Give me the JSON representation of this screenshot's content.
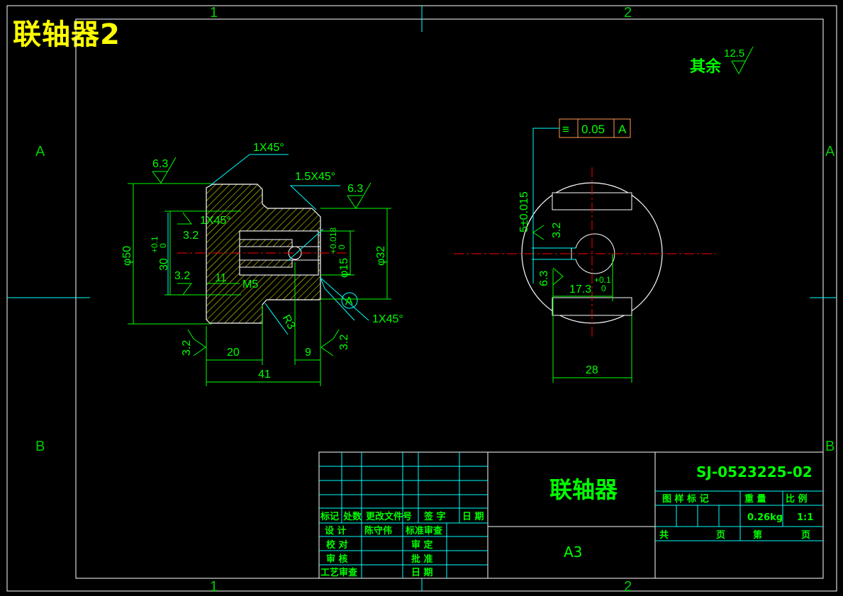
{
  "drawing_title": "联轴器2",
  "frame": {
    "zones_top": [
      "1",
      "2"
    ],
    "zones_bottom": [
      "1",
      "2"
    ],
    "rows_left": [
      "A",
      "B"
    ],
    "rows_right": [
      "A",
      "B"
    ]
  },
  "roughness_note": {
    "label": "其余",
    "value": "12.5"
  },
  "section_view": {
    "chamfers": [
      "1X45°",
      "1.5X45°",
      "1X45°",
      "1X45°"
    ],
    "roughness": [
      "6.3",
      "6.3",
      "3.2",
      "3.2",
      "3.2",
      "3.2"
    ],
    "dims": {
      "dia50": "φ50",
      "dia30": "30",
      "dia30_tol_upper": "+0.1",
      "dia30_tol_lower": "0",
      "dia32": "φ32",
      "dia15": "φ15",
      "dia15_tol_upper": "+0.018",
      "dia15_tol_lower": "0",
      "d11": "11",
      "m5": "M5",
      "r3": "R3",
      "d20": "20",
      "d9": "9",
      "d41": "41",
      "datum": "A"
    }
  },
  "end_view": {
    "tolerance_frame": {
      "symbol": "≡",
      "value": "0.05",
      "datum": "A"
    },
    "dims": {
      "key_width": "5±0.015",
      "roughness_a": "3.2",
      "roughness_b": "6.3",
      "d17": "17.3",
      "d17_tol_upper": "+0.1",
      "d17_tol_lower": "0",
      "d28": "28"
    }
  },
  "title_block": {
    "part_name": "联轴器",
    "drawing_no": "SJ-0523225-02",
    "sheet_size": "A3",
    "col_headers": [
      "标记",
      "处数",
      "更改文件号",
      "签 字",
      "日 期"
    ],
    "rows": [
      {
        "label": "设 计",
        "value": "陈守伟",
        "label2": "标准审查",
        "value2": ""
      },
      {
        "label": "校 对",
        "value": "",
        "label2": "审 定",
        "value2": ""
      },
      {
        "label": "审 核",
        "value": "",
        "label2": "批 准",
        "value2": ""
      },
      {
        "label": "工艺审查",
        "value": "",
        "label2": "日 期",
        "value2": ""
      }
    ],
    "info_headers": [
      "图 样 标 记",
      "重 量",
      "比 例"
    ],
    "weight": "0.26kg",
    "scale": "1:1",
    "sheet_total_label": "共",
    "sheet_unit_label": "页",
    "sheet_num_label": "第",
    "sheet_num_unit": "页"
  },
  "colors": {
    "frame": "#ffffff",
    "geometry": "#ffffff",
    "dimension": "#00ff00",
    "leader": "#00ffff",
    "centerline": "#ff0000",
    "hatch": "#ffff00",
    "tolerance_frame": "#ff9955",
    "title": "#ffff00"
  }
}
